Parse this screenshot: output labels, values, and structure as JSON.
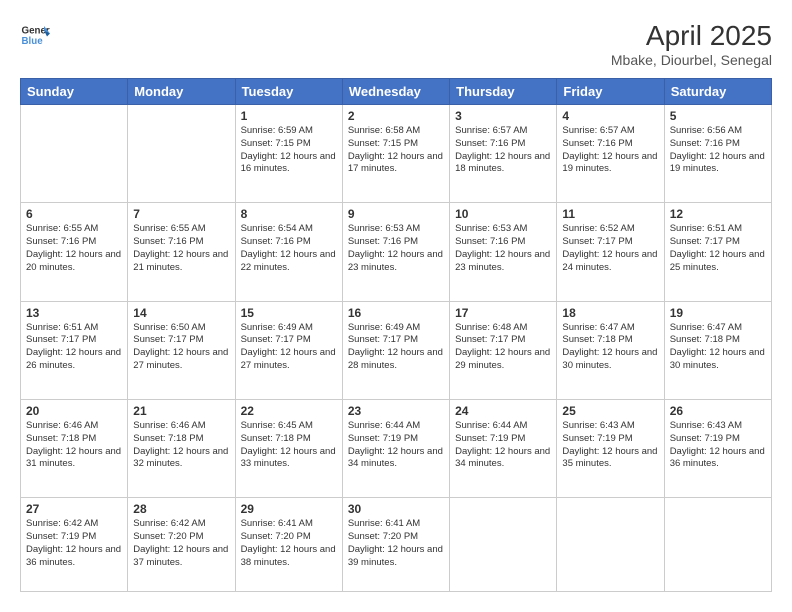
{
  "logo": {
    "line1": "General",
    "line2": "Blue"
  },
  "header": {
    "month_year": "April 2025",
    "location": "Mbake, Diourbel, Senegal"
  },
  "days_of_week": [
    "Sunday",
    "Monday",
    "Tuesday",
    "Wednesday",
    "Thursday",
    "Friday",
    "Saturday"
  ],
  "weeks": [
    [
      {
        "day": "",
        "info": ""
      },
      {
        "day": "",
        "info": ""
      },
      {
        "day": "1",
        "info": "Sunrise: 6:59 AM\nSunset: 7:15 PM\nDaylight: 12 hours and 16 minutes."
      },
      {
        "day": "2",
        "info": "Sunrise: 6:58 AM\nSunset: 7:15 PM\nDaylight: 12 hours and 17 minutes."
      },
      {
        "day": "3",
        "info": "Sunrise: 6:57 AM\nSunset: 7:16 PM\nDaylight: 12 hours and 18 minutes."
      },
      {
        "day": "4",
        "info": "Sunrise: 6:57 AM\nSunset: 7:16 PM\nDaylight: 12 hours and 19 minutes."
      },
      {
        "day": "5",
        "info": "Sunrise: 6:56 AM\nSunset: 7:16 PM\nDaylight: 12 hours and 19 minutes."
      }
    ],
    [
      {
        "day": "6",
        "info": "Sunrise: 6:55 AM\nSunset: 7:16 PM\nDaylight: 12 hours and 20 minutes."
      },
      {
        "day": "7",
        "info": "Sunrise: 6:55 AM\nSunset: 7:16 PM\nDaylight: 12 hours and 21 minutes."
      },
      {
        "day": "8",
        "info": "Sunrise: 6:54 AM\nSunset: 7:16 PM\nDaylight: 12 hours and 22 minutes."
      },
      {
        "day": "9",
        "info": "Sunrise: 6:53 AM\nSunset: 7:16 PM\nDaylight: 12 hours and 23 minutes."
      },
      {
        "day": "10",
        "info": "Sunrise: 6:53 AM\nSunset: 7:16 PM\nDaylight: 12 hours and 23 minutes."
      },
      {
        "day": "11",
        "info": "Sunrise: 6:52 AM\nSunset: 7:17 PM\nDaylight: 12 hours and 24 minutes."
      },
      {
        "day": "12",
        "info": "Sunrise: 6:51 AM\nSunset: 7:17 PM\nDaylight: 12 hours and 25 minutes."
      }
    ],
    [
      {
        "day": "13",
        "info": "Sunrise: 6:51 AM\nSunset: 7:17 PM\nDaylight: 12 hours and 26 minutes."
      },
      {
        "day": "14",
        "info": "Sunrise: 6:50 AM\nSunset: 7:17 PM\nDaylight: 12 hours and 27 minutes."
      },
      {
        "day": "15",
        "info": "Sunrise: 6:49 AM\nSunset: 7:17 PM\nDaylight: 12 hours and 27 minutes."
      },
      {
        "day": "16",
        "info": "Sunrise: 6:49 AM\nSunset: 7:17 PM\nDaylight: 12 hours and 28 minutes."
      },
      {
        "day": "17",
        "info": "Sunrise: 6:48 AM\nSunset: 7:17 PM\nDaylight: 12 hours and 29 minutes."
      },
      {
        "day": "18",
        "info": "Sunrise: 6:47 AM\nSunset: 7:18 PM\nDaylight: 12 hours and 30 minutes."
      },
      {
        "day": "19",
        "info": "Sunrise: 6:47 AM\nSunset: 7:18 PM\nDaylight: 12 hours and 30 minutes."
      }
    ],
    [
      {
        "day": "20",
        "info": "Sunrise: 6:46 AM\nSunset: 7:18 PM\nDaylight: 12 hours and 31 minutes."
      },
      {
        "day": "21",
        "info": "Sunrise: 6:46 AM\nSunset: 7:18 PM\nDaylight: 12 hours and 32 minutes."
      },
      {
        "day": "22",
        "info": "Sunrise: 6:45 AM\nSunset: 7:18 PM\nDaylight: 12 hours and 33 minutes."
      },
      {
        "day": "23",
        "info": "Sunrise: 6:44 AM\nSunset: 7:19 PM\nDaylight: 12 hours and 34 minutes."
      },
      {
        "day": "24",
        "info": "Sunrise: 6:44 AM\nSunset: 7:19 PM\nDaylight: 12 hours and 34 minutes."
      },
      {
        "day": "25",
        "info": "Sunrise: 6:43 AM\nSunset: 7:19 PM\nDaylight: 12 hours and 35 minutes."
      },
      {
        "day": "26",
        "info": "Sunrise: 6:43 AM\nSunset: 7:19 PM\nDaylight: 12 hours and 36 minutes."
      }
    ],
    [
      {
        "day": "27",
        "info": "Sunrise: 6:42 AM\nSunset: 7:19 PM\nDaylight: 12 hours and 36 minutes."
      },
      {
        "day": "28",
        "info": "Sunrise: 6:42 AM\nSunset: 7:20 PM\nDaylight: 12 hours and 37 minutes."
      },
      {
        "day": "29",
        "info": "Sunrise: 6:41 AM\nSunset: 7:20 PM\nDaylight: 12 hours and 38 minutes."
      },
      {
        "day": "30",
        "info": "Sunrise: 6:41 AM\nSunset: 7:20 PM\nDaylight: 12 hours and 39 minutes."
      },
      {
        "day": "",
        "info": ""
      },
      {
        "day": "",
        "info": ""
      },
      {
        "day": "",
        "info": ""
      }
    ]
  ]
}
